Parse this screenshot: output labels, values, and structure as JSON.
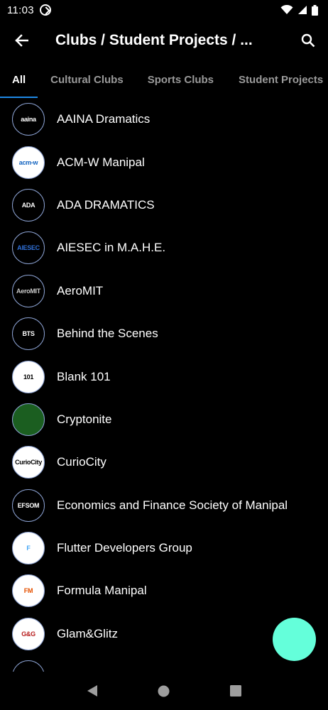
{
  "status_bar": {
    "time": "11:03"
  },
  "app_bar": {
    "title": "Clubs / Student Projects / ..."
  },
  "tabs": [
    {
      "label": "All",
      "active": true
    },
    {
      "label": "Cultural Clubs",
      "active": false
    },
    {
      "label": "Sports Clubs",
      "active": false
    },
    {
      "label": "Student Projects",
      "active": false
    }
  ],
  "clubs": [
    {
      "name": "AAINA Dramatics",
      "logo_text": "aaina",
      "logo_bg": "#000000",
      "logo_fg": "#ffffff"
    },
    {
      "name": "ACM-W Manipal",
      "logo_text": "acm-w",
      "logo_bg": "#ffffff",
      "logo_fg": "#1565c0"
    },
    {
      "name": "ADA DRAMATICS",
      "logo_text": "ADA",
      "logo_bg": "#000000",
      "logo_fg": "#ffffff"
    },
    {
      "name": "AIESEC in M.A.H.E.",
      "logo_text": "AIESEC",
      "logo_bg": "#000000",
      "logo_fg": "#2f6fd6"
    },
    {
      "name": "AeroMIT",
      "logo_text": "AeroMIT",
      "logo_bg": "#000000",
      "logo_fg": "#cccccc"
    },
    {
      "name": "Behind the Scenes",
      "logo_text": "BTS",
      "logo_bg": "#000000",
      "logo_fg": "#ffffff"
    },
    {
      "name": "Blank 101",
      "logo_text": "101",
      "logo_bg": "#ffffff",
      "logo_fg": "#000000"
    },
    {
      "name": "Cryptonite",
      "logo_text": "",
      "logo_bg": "#1b5e20",
      "logo_fg": "#000000"
    },
    {
      "name": "CurioCity",
      "logo_text": "CurioCity",
      "logo_bg": "#ffffff",
      "logo_fg": "#000000"
    },
    {
      "name": "Economics and Finance Society of Manipal",
      "logo_text": "EFSOM",
      "logo_bg": "#000000",
      "logo_fg": "#ffffff"
    },
    {
      "name": "Flutter Developers Group",
      "logo_text": "F",
      "logo_bg": "#ffffff",
      "logo_fg": "#42a5f5"
    },
    {
      "name": "Formula Manipal",
      "logo_text": "FM",
      "logo_bg": "#ffffff",
      "logo_fg": "#e65100"
    },
    {
      "name": "Glam&Glitz",
      "logo_text": "G&G",
      "logo_bg": "#ffffff",
      "logo_fg": "#b71c1c"
    },
    {
      "name": "",
      "logo_text": "",
      "logo_bg": "#000000",
      "logo_fg": "#ffffff"
    }
  ],
  "icons": {
    "back": "arrow-left-icon",
    "search": "search-icon",
    "wifi": "wifi-icon",
    "signal": "signal-icon",
    "battery": "battery-icon",
    "nav_back": "triangle-back-icon",
    "nav_home": "circle-home-icon",
    "nav_recents": "square-recents-icon"
  },
  "colors": {
    "background": "#000000",
    "accent": "#1e88e5",
    "fab": "#64ffda",
    "tab_inactive": "#9a9a9a"
  }
}
